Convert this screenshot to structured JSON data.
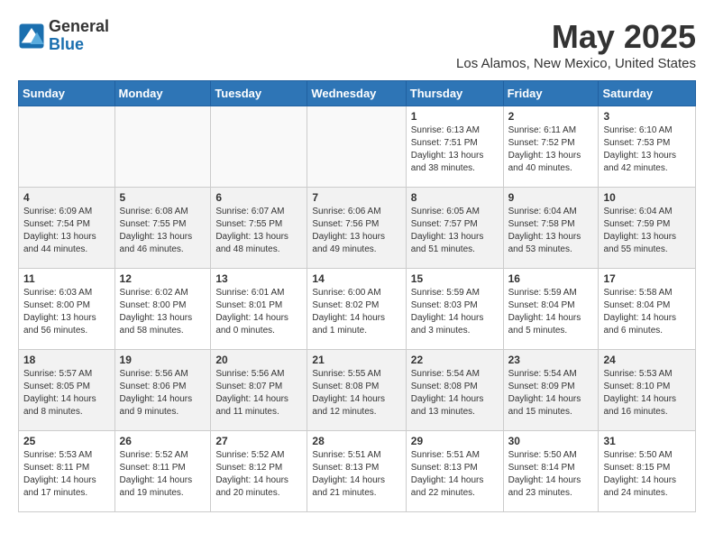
{
  "header": {
    "logo_general": "General",
    "logo_blue": "Blue",
    "month_title": "May 2025",
    "location": "Los Alamos, New Mexico, United States"
  },
  "weekdays": [
    "Sunday",
    "Monday",
    "Tuesday",
    "Wednesday",
    "Thursday",
    "Friday",
    "Saturday"
  ],
  "weeks": [
    [
      {
        "day": "",
        "info": ""
      },
      {
        "day": "",
        "info": ""
      },
      {
        "day": "",
        "info": ""
      },
      {
        "day": "",
        "info": ""
      },
      {
        "day": "1",
        "info": "Sunrise: 6:13 AM\nSunset: 7:51 PM\nDaylight: 13 hours\nand 38 minutes."
      },
      {
        "day": "2",
        "info": "Sunrise: 6:11 AM\nSunset: 7:52 PM\nDaylight: 13 hours\nand 40 minutes."
      },
      {
        "day": "3",
        "info": "Sunrise: 6:10 AM\nSunset: 7:53 PM\nDaylight: 13 hours\nand 42 minutes."
      }
    ],
    [
      {
        "day": "4",
        "info": "Sunrise: 6:09 AM\nSunset: 7:54 PM\nDaylight: 13 hours\nand 44 minutes."
      },
      {
        "day": "5",
        "info": "Sunrise: 6:08 AM\nSunset: 7:55 PM\nDaylight: 13 hours\nand 46 minutes."
      },
      {
        "day": "6",
        "info": "Sunrise: 6:07 AM\nSunset: 7:55 PM\nDaylight: 13 hours\nand 48 minutes."
      },
      {
        "day": "7",
        "info": "Sunrise: 6:06 AM\nSunset: 7:56 PM\nDaylight: 13 hours\nand 49 minutes."
      },
      {
        "day": "8",
        "info": "Sunrise: 6:05 AM\nSunset: 7:57 PM\nDaylight: 13 hours\nand 51 minutes."
      },
      {
        "day": "9",
        "info": "Sunrise: 6:04 AM\nSunset: 7:58 PM\nDaylight: 13 hours\nand 53 minutes."
      },
      {
        "day": "10",
        "info": "Sunrise: 6:04 AM\nSunset: 7:59 PM\nDaylight: 13 hours\nand 55 minutes."
      }
    ],
    [
      {
        "day": "11",
        "info": "Sunrise: 6:03 AM\nSunset: 8:00 PM\nDaylight: 13 hours\nand 56 minutes."
      },
      {
        "day": "12",
        "info": "Sunrise: 6:02 AM\nSunset: 8:00 PM\nDaylight: 13 hours\nand 58 minutes."
      },
      {
        "day": "13",
        "info": "Sunrise: 6:01 AM\nSunset: 8:01 PM\nDaylight: 14 hours\nand 0 minutes."
      },
      {
        "day": "14",
        "info": "Sunrise: 6:00 AM\nSunset: 8:02 PM\nDaylight: 14 hours\nand 1 minute."
      },
      {
        "day": "15",
        "info": "Sunrise: 5:59 AM\nSunset: 8:03 PM\nDaylight: 14 hours\nand 3 minutes."
      },
      {
        "day": "16",
        "info": "Sunrise: 5:59 AM\nSunset: 8:04 PM\nDaylight: 14 hours\nand 5 minutes."
      },
      {
        "day": "17",
        "info": "Sunrise: 5:58 AM\nSunset: 8:04 PM\nDaylight: 14 hours\nand 6 minutes."
      }
    ],
    [
      {
        "day": "18",
        "info": "Sunrise: 5:57 AM\nSunset: 8:05 PM\nDaylight: 14 hours\nand 8 minutes."
      },
      {
        "day": "19",
        "info": "Sunrise: 5:56 AM\nSunset: 8:06 PM\nDaylight: 14 hours\nand 9 minutes."
      },
      {
        "day": "20",
        "info": "Sunrise: 5:56 AM\nSunset: 8:07 PM\nDaylight: 14 hours\nand 11 minutes."
      },
      {
        "day": "21",
        "info": "Sunrise: 5:55 AM\nSunset: 8:08 PM\nDaylight: 14 hours\nand 12 minutes."
      },
      {
        "day": "22",
        "info": "Sunrise: 5:54 AM\nSunset: 8:08 PM\nDaylight: 14 hours\nand 13 minutes."
      },
      {
        "day": "23",
        "info": "Sunrise: 5:54 AM\nSunset: 8:09 PM\nDaylight: 14 hours\nand 15 minutes."
      },
      {
        "day": "24",
        "info": "Sunrise: 5:53 AM\nSunset: 8:10 PM\nDaylight: 14 hours\nand 16 minutes."
      }
    ],
    [
      {
        "day": "25",
        "info": "Sunrise: 5:53 AM\nSunset: 8:11 PM\nDaylight: 14 hours\nand 17 minutes."
      },
      {
        "day": "26",
        "info": "Sunrise: 5:52 AM\nSunset: 8:11 PM\nDaylight: 14 hours\nand 19 minutes."
      },
      {
        "day": "27",
        "info": "Sunrise: 5:52 AM\nSunset: 8:12 PM\nDaylight: 14 hours\nand 20 minutes."
      },
      {
        "day": "28",
        "info": "Sunrise: 5:51 AM\nSunset: 8:13 PM\nDaylight: 14 hours\nand 21 minutes."
      },
      {
        "day": "29",
        "info": "Sunrise: 5:51 AM\nSunset: 8:13 PM\nDaylight: 14 hours\nand 22 minutes."
      },
      {
        "day": "30",
        "info": "Sunrise: 5:50 AM\nSunset: 8:14 PM\nDaylight: 14 hours\nand 23 minutes."
      },
      {
        "day": "31",
        "info": "Sunrise: 5:50 AM\nSunset: 8:15 PM\nDaylight: 14 hours\nand 24 minutes."
      }
    ]
  ]
}
